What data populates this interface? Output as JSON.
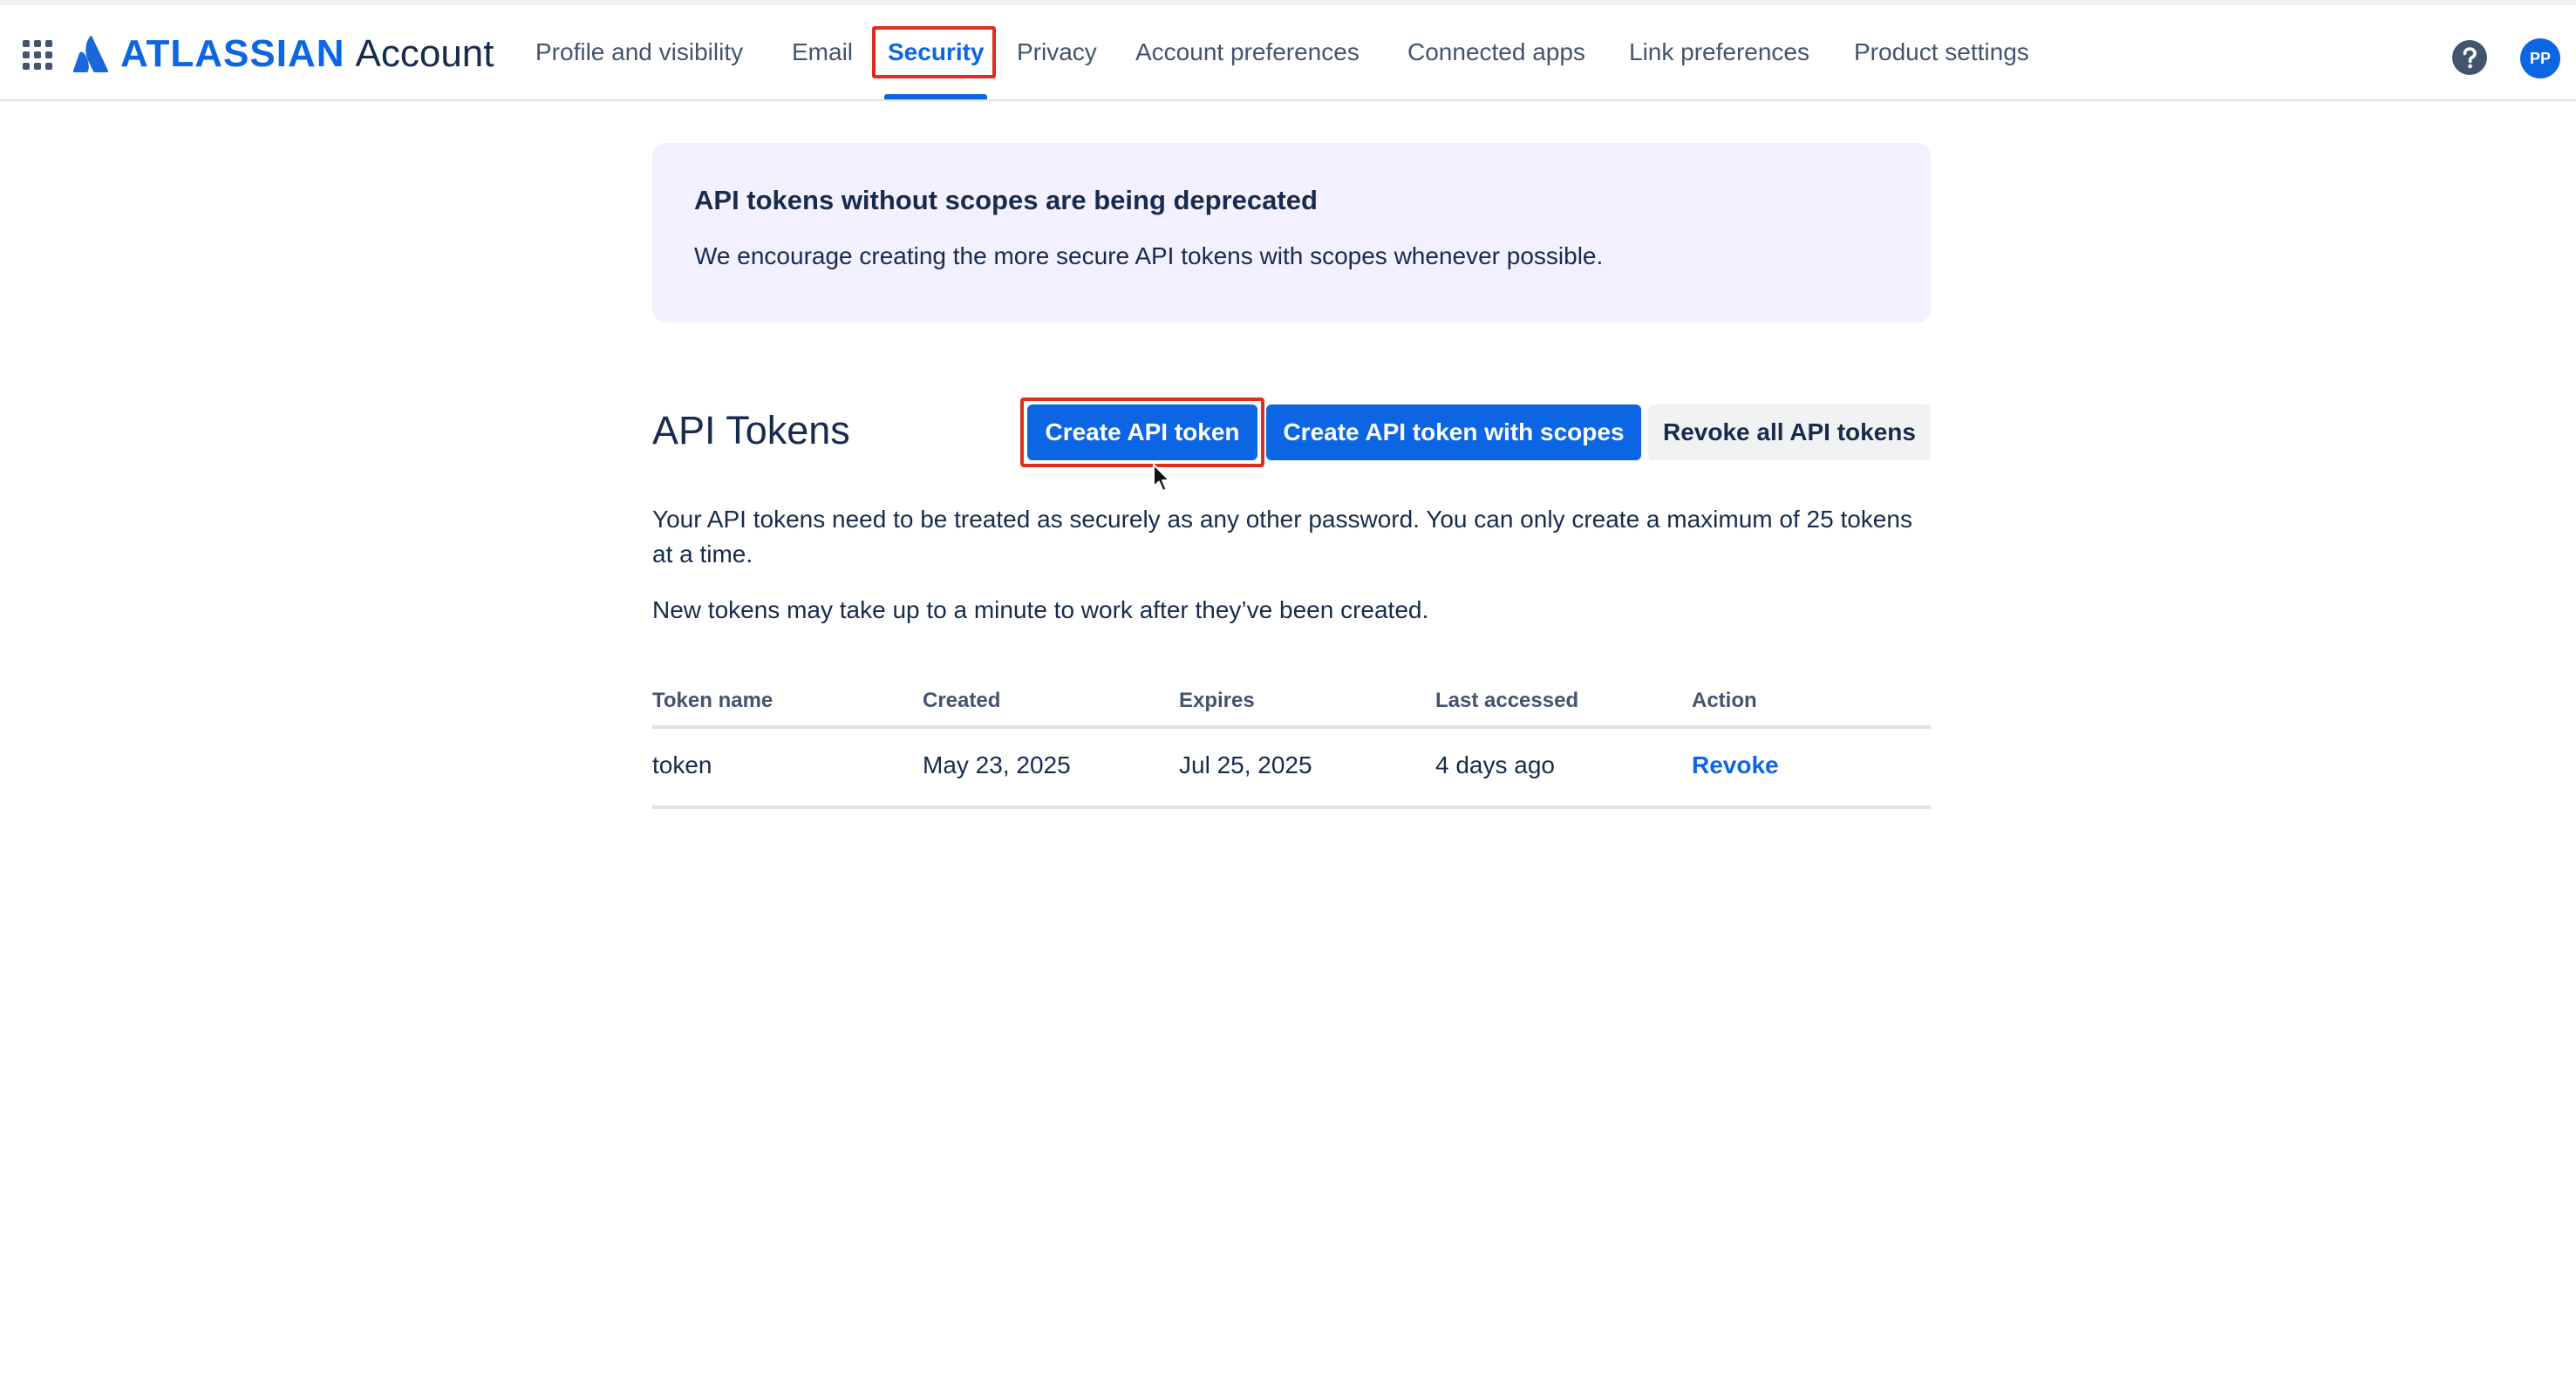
{
  "header": {
    "brand": "ATLASSIAN",
    "product": "Account",
    "avatar_initials": "PP",
    "nav": [
      {
        "label": "Profile and visibility"
      },
      {
        "label": "Email"
      },
      {
        "label": "Security",
        "active": true
      },
      {
        "label": "Privacy"
      },
      {
        "label": "Account preferences"
      },
      {
        "label": "Connected apps"
      },
      {
        "label": "Link preferences"
      },
      {
        "label": "Product settings"
      }
    ]
  },
  "banner": {
    "title": "API tokens without scopes are being deprecated",
    "text": "We encourage creating the more secure API tokens with scopes whenever possible."
  },
  "section": {
    "title": "API Tokens",
    "buttons": {
      "create": "Create API token",
      "create_scopes": "Create API token with scopes",
      "revoke_all": "Revoke all API tokens"
    },
    "description_1": "Your API tokens need to be treated as securely as any other password. You can only create a maximum of 25 tokens at a time.",
    "description_2": "New tokens may take up to a minute to work after they’ve been created."
  },
  "table": {
    "columns": [
      "Token name",
      "Created",
      "Expires",
      "Last accessed",
      "Action"
    ],
    "rows": [
      {
        "name": "token",
        "created": "May 23, 2025",
        "expires": "Jul 25, 2025",
        "last_accessed": "4 days ago",
        "action": "Revoke"
      }
    ]
  },
  "colors": {
    "accent": "#0c66e4",
    "highlight": "#e02b1f",
    "banner_bg": "#f3f0ff"
  },
  "icons": [
    "app-switcher-icon",
    "atlassian-logo-icon",
    "help-icon",
    "mouse-cursor-icon"
  ]
}
